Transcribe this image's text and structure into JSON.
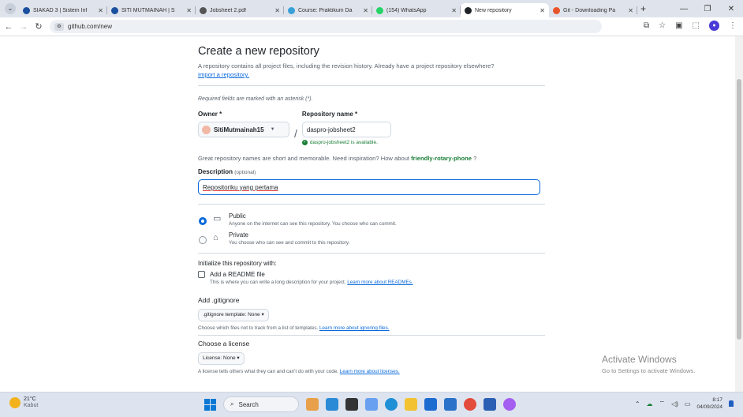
{
  "browser": {
    "tabs": [
      {
        "title": "SIAKAD 3 | Sistem Inf",
        "color": "#1b4fa0"
      },
      {
        "title": "SITI MUTMAINAH | S",
        "color": "#1b4fa0"
      },
      {
        "title": "Jobsheet 2.pdf",
        "color": "#555555"
      },
      {
        "title": "Course: Praktikum Da",
        "color": "#3aa0d8"
      },
      {
        "title": "(154) WhatsApp",
        "color": "#25d366"
      },
      {
        "title": "New repository",
        "color": "#1f2328",
        "active": true
      },
      {
        "title": "Git - Downloading Pa",
        "color": "#e8542c"
      }
    ],
    "url": "github.com/new"
  },
  "page": {
    "title": "Create a new repository",
    "lead": "A repository contains all project files, including the revision history. Already have a project repository elsewhere?",
    "import_link": "Import a repository.",
    "required_note": "Required fields are marked with an asterisk (*).",
    "owner_label": "Owner *",
    "owner_value": "SitiMutmainah15",
    "slash": "/",
    "repo_label": "Repository name *",
    "repo_value": "daspro-jobsheet2",
    "available": "daspro-jobsheet2 is available.",
    "great_text": "Great repository names are short and memorable. Need inspiration? How about",
    "suggestion": "friendly-rotary-phone",
    "suggestion_end": " ?",
    "desc_label": "Description",
    "desc_optional": "(optional)",
    "desc_value": "Repositoriku yang pertama",
    "public_title": "Public",
    "public_sub": "Anyone on the internet can see this repository. You choose who can commit.",
    "private_title": "Private",
    "private_sub": "You choose who can see and commit to this repository.",
    "init_title": "Initialize this repository with:",
    "readme_label": "Add a README file",
    "readme_sub": "This is where you can write a long description for your project.",
    "readme_link": "Learn more about READMEs.",
    "gitignore_title": "Add .gitignore",
    "gitignore_value": ".gitignore template: None",
    "gitignore_help": "Choose which files not to track from a list of templates.",
    "gitignore_link": "Learn more about ignoring files.",
    "license_title": "Choose a license",
    "license_value": "License: None",
    "license_help": "A license tells others what they can and can't do with your code.",
    "license_link": "Learn more about licenses."
  },
  "watermark": {
    "line1": "Activate Windows",
    "line2": "Go to Settings to activate Windows."
  },
  "taskbar": {
    "temp": "21°C",
    "weather": "Kabut",
    "search": "Search",
    "time": "8:17",
    "date": "04/09/2024"
  }
}
